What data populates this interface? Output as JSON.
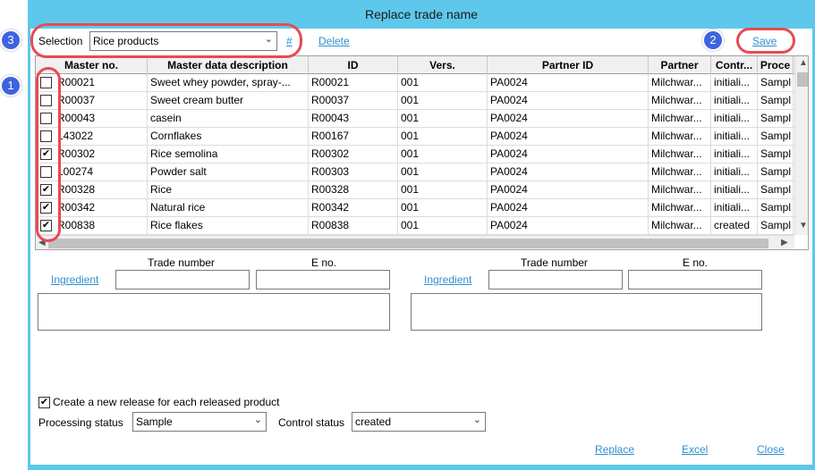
{
  "window": {
    "title": "Replace trade name"
  },
  "selection": {
    "label": "Selection",
    "value": "Rice products",
    "hash_link": "#",
    "delete_link": "Delete",
    "save_link": "Save"
  },
  "grid": {
    "columns": [
      "Master no.",
      "Master data description",
      "ID",
      "Vers.",
      "Partner ID",
      "Partner",
      "Contr...",
      "Proce"
    ],
    "rows": [
      {
        "checked": false,
        "master_no": "R00021",
        "description": "Sweet whey powder, spray-...",
        "id": "R00021",
        "vers": "001",
        "partner_id": "PA0024",
        "partner": "Milchwar...",
        "control": "initiali...",
        "process": "Sampl"
      },
      {
        "checked": false,
        "master_no": "R00037",
        "description": "Sweet cream butter",
        "id": "R00037",
        "vers": "001",
        "partner_id": "PA0024",
        "partner": "Milchwar...",
        "control": "initiali...",
        "process": "Sampl"
      },
      {
        "checked": false,
        "master_no": "R00043",
        "description": "casein",
        "id": "R00043",
        "vers": "001",
        "partner_id": "PA0024",
        "partner": "Milchwar...",
        "control": "initiali...",
        "process": "Sampl"
      },
      {
        "checked": false,
        "master_no": "143022",
        "description": "Cornflakes",
        "id": "R00167",
        "vers": "001",
        "partner_id": "PA0024",
        "partner": "Milchwar...",
        "control": "initiali...",
        "process": "Sampl"
      },
      {
        "checked": true,
        "master_no": "R00302",
        "description": "Rice semolina",
        "id": "R00302",
        "vers": "001",
        "partner_id": "PA0024",
        "partner": "Milchwar...",
        "control": "initiali...",
        "process": "Sampl"
      },
      {
        "checked": false,
        "master_no": "100274",
        "description": "Powder salt",
        "id": "R00303",
        "vers": "001",
        "partner_id": "PA0024",
        "partner": "Milchwar...",
        "control": "initiali...",
        "process": "Sampl"
      },
      {
        "checked": true,
        "master_no": "R00328",
        "description": "Rice",
        "id": "R00328",
        "vers": "001",
        "partner_id": "PA0024",
        "partner": "Milchwar...",
        "control": "initiali...",
        "process": "Sampl"
      },
      {
        "checked": true,
        "master_no": "R00342",
        "description": "Natural rice",
        "id": "R00342",
        "vers": "001",
        "partner_id": "PA0024",
        "partner": "Milchwar...",
        "control": "initiali...",
        "process": "Sampl"
      },
      {
        "checked": true,
        "master_no": "R00838",
        "description": "Rice flakes",
        "id": "R00838",
        "vers": "001",
        "partner_id": "PA0024",
        "partner": "Milchwar...",
        "control": "created",
        "process": "Sampl"
      }
    ]
  },
  "left_panel": {
    "trade_number_label": "Trade number",
    "e_no_label": "E no.",
    "ingredient_link": "Ingredient"
  },
  "right_panel": {
    "trade_number_label": "Trade number",
    "e_no_label": "E no.",
    "ingredient_link": "Ingredient"
  },
  "options": {
    "new_release_checked": true,
    "new_release_label": "Create a new release for each released product",
    "processing_status_label": "Processing status",
    "processing_status_value": "Sample",
    "control_status_label": "Control status",
    "control_status_value": "created"
  },
  "footer": {
    "replace": "Replace",
    "excel": "Excel",
    "close": "Close"
  },
  "annotations": {
    "badge1": "1",
    "badge2": "2",
    "badge3": "3"
  },
  "colors": {
    "window_frame": "#5ec8ec",
    "link": "#2f8fd0",
    "highlight_ring": "#e84a55",
    "badge": "#3e63dd"
  },
  "icons": {
    "dropdown": "chevron-down-icon",
    "check": "checkmark-icon"
  }
}
